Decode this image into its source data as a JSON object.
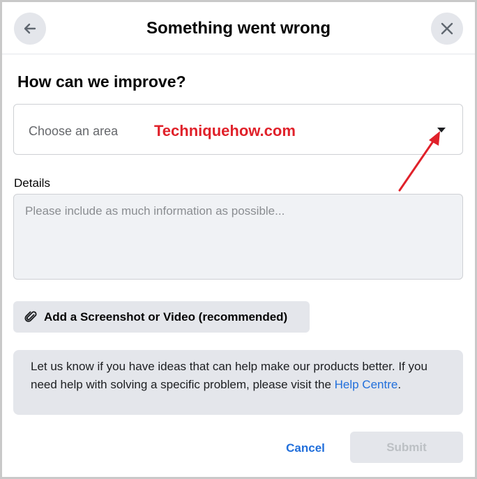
{
  "header": {
    "title": "Something went wrong",
    "back_icon": "arrow-left-icon",
    "close_icon": "close-icon"
  },
  "form": {
    "heading": "How can we improve?",
    "area_select": {
      "placeholder": "Choose an area",
      "caret_icon": "caret-down-icon"
    },
    "details": {
      "label": "Details",
      "value": "",
      "placeholder": "Please include as much information as possible..."
    },
    "attach": {
      "label": "Add a Screenshot or Video (recommended)",
      "icon": "paperclip-icon"
    },
    "info": {
      "text": "Let us know if you have ideas that can help make our products better. If you need help with solving a specific problem, please visit the ",
      "link_text": "Help Centre",
      "suffix": "."
    }
  },
  "footer": {
    "cancel_label": "Cancel",
    "submit_label": "Submit"
  },
  "overlay": {
    "watermark": "Techniquehow.com",
    "annotation_color": "#e0212a"
  },
  "colors": {
    "link": "#216fdb",
    "button_bg": "#e4e6eb",
    "disabled_text": "#bcc0c4"
  }
}
